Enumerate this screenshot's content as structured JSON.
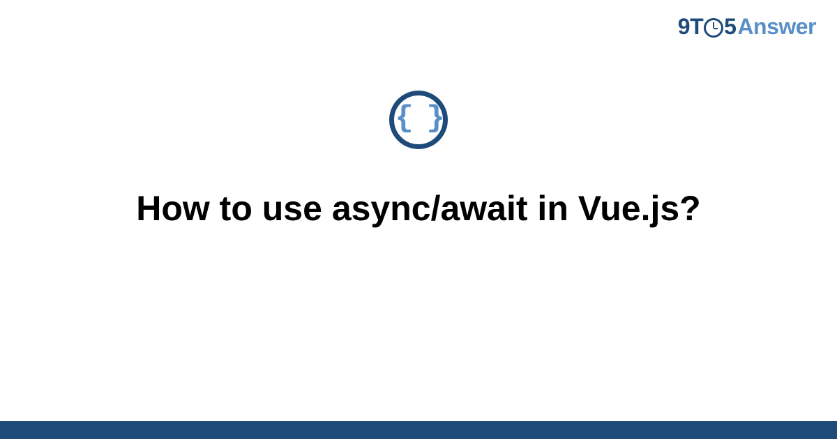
{
  "header": {
    "logo_part1": "9T",
    "logo_part2": "5",
    "logo_part3": "Answer"
  },
  "badge": {
    "symbol": "{ }",
    "icon_name": "code-braces-icon"
  },
  "main": {
    "title": "How to use async/await in Vue.js?"
  },
  "colors": {
    "brand_dark": "#1e4b7a",
    "brand_light": "#5a8fc7",
    "text": "#000000",
    "background": "#ffffff"
  }
}
